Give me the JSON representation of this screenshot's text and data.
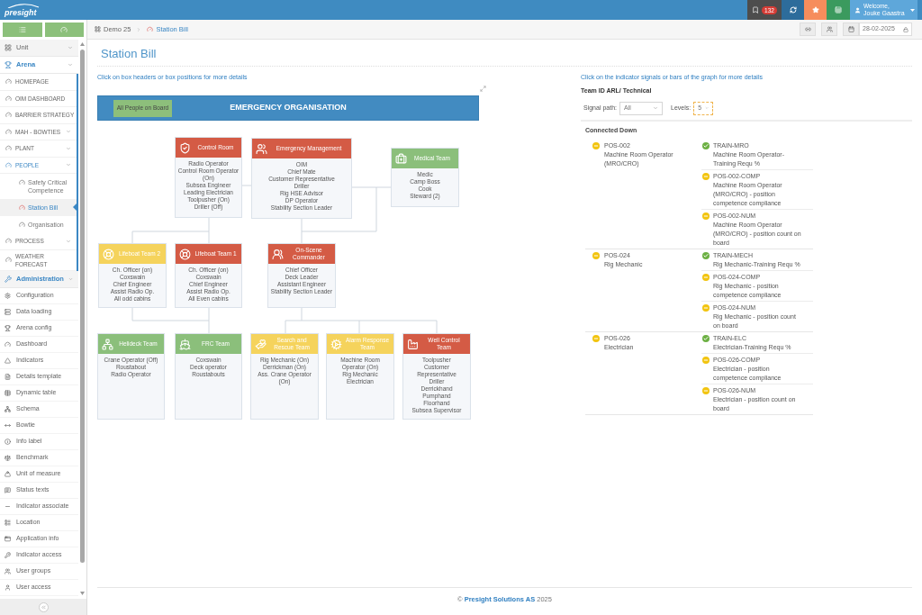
{
  "header": {
    "logo": "presight",
    "badge": "132",
    "user": {
      "greeting": "Welcome,",
      "name": "Jouke Gaastra"
    }
  },
  "sidebar": {
    "sections": [
      {
        "label": "Unit",
        "expanded": false
      },
      {
        "label": "Arena",
        "expanded": true,
        "children": [
          {
            "label": "HOMEPAGE",
            "expandable": false,
            "expanded": false
          },
          {
            "label": "OIM DASHBOARD",
            "expandable": false,
            "expanded": false
          },
          {
            "label": "BARRIER STRATEGY",
            "expandable": false,
            "expanded": false
          },
          {
            "label": "MAH - BOWTIES",
            "expandable": true,
            "expanded": false
          },
          {
            "label": "PLANT",
            "expandable": true,
            "expanded": false
          },
          {
            "label": "PEOPLE",
            "expandable": true,
            "expanded": true,
            "children": [
              {
                "label": "Safety Critical Competence",
                "selected": false
              },
              {
                "label": "Station Bill",
                "selected": true
              },
              {
                "label": "Organisation",
                "selected": false
              }
            ]
          },
          {
            "label": "PROCESS",
            "expandable": true,
            "expanded": false
          },
          {
            "label": "WEATHER FORECAST",
            "expandable": false,
            "expanded": false
          }
        ]
      },
      {
        "label": "Administration",
        "expanded": true,
        "children": [
          {
            "label": "Configuration"
          },
          {
            "label": "Data loading"
          },
          {
            "label": "Arena config"
          },
          {
            "label": "Dashboard"
          },
          {
            "label": "Indicators"
          },
          {
            "label": "Details template"
          },
          {
            "label": "Dynamic table"
          },
          {
            "label": "Schema"
          },
          {
            "label": "Bowtie"
          },
          {
            "label": "Info label"
          },
          {
            "label": "Benchmark"
          },
          {
            "label": "Unit of measure"
          },
          {
            "label": "Status texts"
          },
          {
            "label": "Indicator associate"
          },
          {
            "label": "Location"
          },
          {
            "label": "Application info"
          },
          {
            "label": "Indicator access"
          },
          {
            "label": "User groups"
          },
          {
            "label": "User access"
          }
        ]
      }
    ]
  },
  "breadcrumb": [
    {
      "label": "Demo 25",
      "current": false
    },
    {
      "label": "Station Bill",
      "current": true
    }
  ],
  "date": "28-02-2025",
  "page_title": "Station Bill",
  "left": {
    "hint": "Click on box headers or box positions for more details",
    "chart": {
      "button": "All People on Board",
      "title": "EMERGENCY ORGANISATION",
      "nodes": [
        {
          "title": "Control Room",
          "color": "#d45b45",
          "members": [
            "Radio Operator",
            "Control Room Operator (On)",
            "Subsea Engineer",
            "Leading Electrician",
            "Toolpusher (On)",
            "Driller (Off)"
          ]
        },
        {
          "title": "Emergency Management",
          "color": "#d45b45",
          "members": [
            "OIM",
            "Chief Mate",
            "Customer Representative",
            "Driller",
            "Rig HSE Advisor",
            "DP Operator",
            "Stability Section Leader"
          ]
        },
        {
          "title": "Medical Team",
          "color": "#8bbf7b",
          "members": [
            "Medic",
            "Camp Boss",
            "Cook",
            "Steward (2)"
          ]
        },
        {
          "title": "Lifeboat Team 2",
          "color": "#f5d35c",
          "members": [
            "Ch. Officer (on)",
            "Coxswain",
            "Chief Engineer",
            "Assist Radio Op.",
            "All odd cabins"
          ]
        },
        {
          "title": "Lifeboat Team 1",
          "color": "#d45b45",
          "members": [
            "Ch. Officer (on)",
            "Coxswain",
            "Chief Engineer",
            "Assist Radio Op.",
            "All Even cabins"
          ]
        },
        {
          "title": "On-Scene Commander",
          "color": "#d45b45",
          "members": [
            "Chief Officer",
            "Deck Leader",
            "Assistant Engineer",
            "Stability Section Leader"
          ]
        },
        {
          "title": "Helideck Team",
          "color": "#8bbf7b",
          "members": [
            "Crane Operator (Off)",
            "Roustabout",
            "Radio Operator"
          ]
        },
        {
          "title": "FRC Team",
          "color": "#8bbf7b",
          "members": [
            "Coxswain",
            "Deck operator",
            "Roustabouts"
          ]
        },
        {
          "title": "Search and Rescue Team",
          "color": "#f5d35c",
          "members": [
            "Rig Mechanic (On)",
            "Derrickman (On)",
            "Ass. Crane Operator (On)"
          ]
        },
        {
          "title": "Alarm Response Team",
          "color": "#f5d35c",
          "members": [
            "Machine Room Operator (On)",
            "Rig Mechanic",
            "Electrician"
          ]
        },
        {
          "title": "Well Control Team",
          "color": "#d45b45",
          "members": [
            "Toolpusher",
            "Customer Representative",
            "Driller",
            "Derrickhand",
            "Pumphand",
            "Floorhand",
            "Subsea Supervisor"
          ]
        }
      ]
    }
  },
  "right": {
    "hint": "Click on the indicator signals or bars of the graph for more details",
    "team": "Team ID ARL/ Technical",
    "filters": [
      {
        "label": "Signal path:",
        "value": "All",
        "focused": false
      },
      {
        "label": "Levels:",
        "value": "5",
        "focused": true
      }
    ],
    "section": "Connected Down",
    "positions": [
      {
        "code": "POS-002",
        "name": "Machine Room Operator (MRO/CRO)",
        "passed": false,
        "indicators": [
          {
            "code": "TRAIN-MRO",
            "name": "Machine Room Operator-Training Requ %",
            "passed": true
          },
          {
            "code": "POS-002-COMP",
            "name": "Machine Room Operator (MRO/CRO) - position competence compliance",
            "passed": false
          },
          {
            "code": "POS-002-NUM",
            "name": "Machine Room Operator (MRO/CRO) - position count on board",
            "passed": false
          }
        ]
      },
      {
        "code": "POS-024",
        "name": "Rig Mechanic",
        "passed": false,
        "indicators": [
          {
            "code": "TRAIN-MECH",
            "name": "Rig Mechanic-Training Requ %",
            "passed": true
          },
          {
            "code": "POS-024-COMP",
            "name": "Rig Mechanic - position competence compliance",
            "passed": false
          },
          {
            "code": "POS-024-NUM",
            "name": "Rig Mechanic - position count on board",
            "passed": false
          }
        ]
      },
      {
        "code": "POS-026",
        "name": "Electrician",
        "passed": false,
        "indicators": [
          {
            "code": "TRAIN-ELC",
            "name": "Electrician-Training Requ %",
            "passed": true
          },
          {
            "code": "POS-026-COMP",
            "name": "Electrician - position competence compliance",
            "passed": false
          },
          {
            "code": "POS-026-NUM",
            "name": "Electrician - position count on board",
            "passed": false
          }
        ]
      }
    ]
  },
  "footer": {
    "prefix": "©",
    "link": "Presight Solutions AS",
    "year": "2025"
  }
}
